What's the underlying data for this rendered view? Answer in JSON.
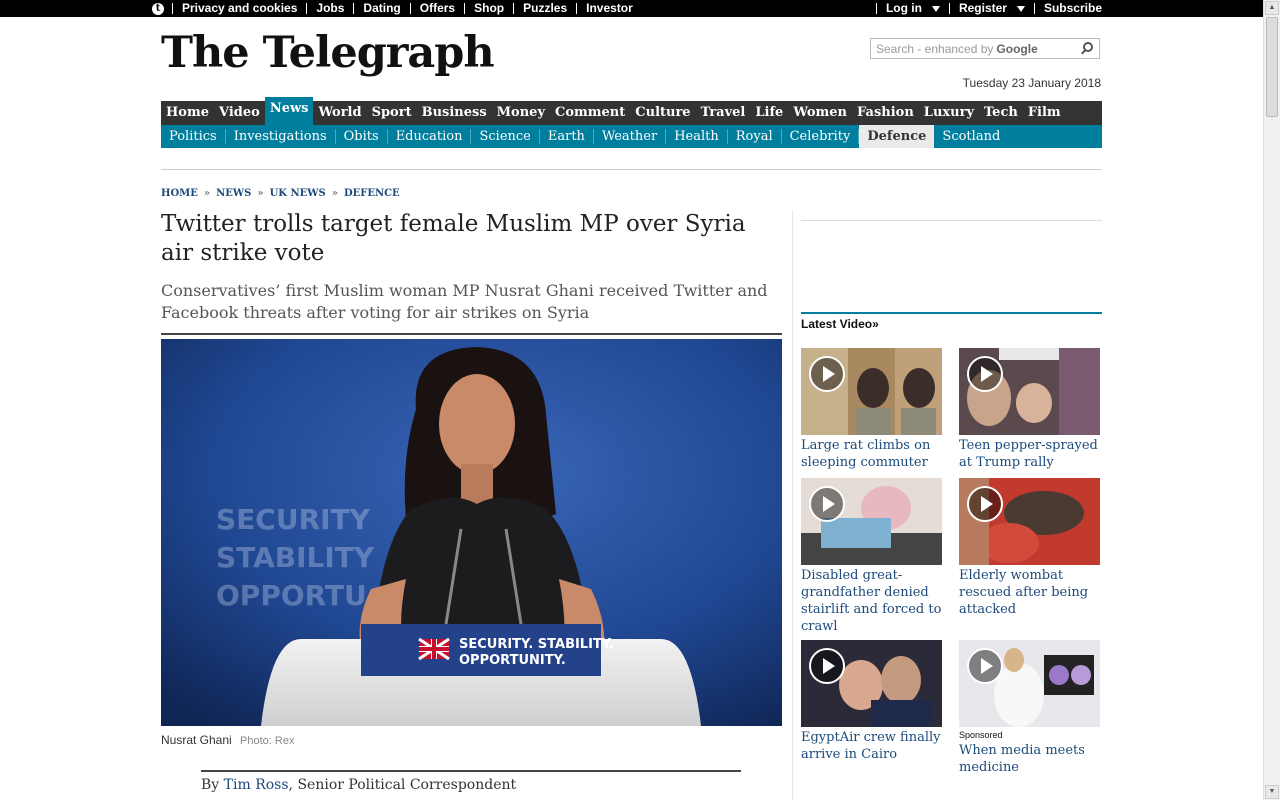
{
  "topbar": {
    "left_links": [
      "Privacy and cookies",
      "Jobs",
      "Dating",
      "Offers",
      "Shop",
      "Puzzles",
      "Investor"
    ],
    "login": "Log in",
    "register": "Register",
    "subscribe": "Subscribe"
  },
  "masthead": {
    "logo": "The Telegraph",
    "search_placeholder": "Search - enhanced by",
    "search_brand": "Google",
    "date": "Tuesday 23 January 2018"
  },
  "nav": {
    "primary": [
      "Home",
      "Video",
      "News",
      "World",
      "Sport",
      "Business",
      "Money",
      "Comment",
      "Culture",
      "Travel",
      "Life",
      "Women",
      "Fashion",
      "Luxury",
      "Tech",
      "Film"
    ],
    "primary_active": "News",
    "secondary": [
      "Politics",
      "Investigations",
      "Obits",
      "Education",
      "Science",
      "Earth",
      "Weather",
      "Health",
      "Royal",
      "Celebrity",
      "Defence",
      "Scotland"
    ],
    "secondary_active": "Defence"
  },
  "breadcrumb": [
    "HOME",
    "NEWS",
    "UK NEWS",
    "DEFENCE"
  ],
  "article": {
    "headline": "Twitter trolls target female Muslim MP over Syria air strike vote",
    "standfirst": "Conservatives’ first Muslim woman MP Nusrat Ghani received Twitter and Facebook threats after voting for air strikes on Syria",
    "photo_podium_text_1": "SECURITY. STABILITY.",
    "photo_podium_text_2": "OPPORTUNITY.",
    "photo_bg_text": [
      "SECURITY",
      "STABILITY",
      "OPPORTU"
    ],
    "caption": "Nusrat Ghani",
    "photo_credit": "Photo: Rex",
    "byline_prefix": "By",
    "author": "Tim Ross",
    "author_role": ", Senior Political Correspondent"
  },
  "sidebar": {
    "latest_video_label": "Latest Video»",
    "videos": [
      {
        "title": "Large rat climbs on sleeping commuter",
        "sponsored": ""
      },
      {
        "title": "Teen pepper-sprayed at Trump rally",
        "sponsored": ""
      },
      {
        "title": "Disabled great-grandfather denied stairlift and forced to crawl",
        "sponsored": ""
      },
      {
        "title": "Elderly wombat rescued after being attacked",
        "sponsored": ""
      },
      {
        "title": "EgyptAir crew finally arrive in Cairo",
        "sponsored": ""
      },
      {
        "title": "When media meets medicine",
        "sponsored": "Sponsored"
      }
    ]
  },
  "colors": {
    "nav_dark": "#333333",
    "accent_teal": "#007e9d",
    "link_blue": "#1b4a7b"
  }
}
